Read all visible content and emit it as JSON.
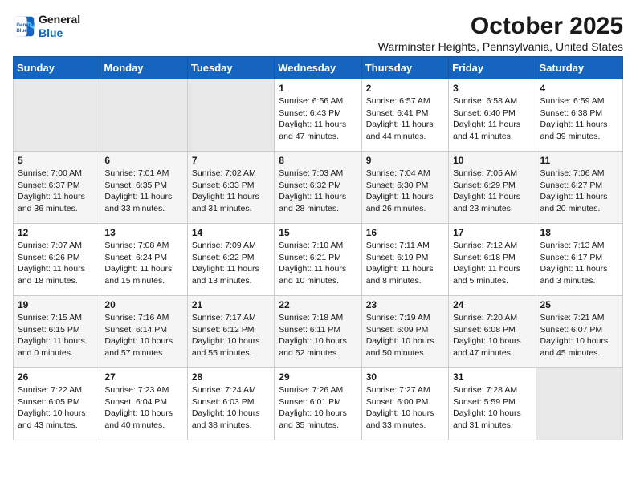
{
  "logo": {
    "line1": "General",
    "line2": "Blue"
  },
  "title": "October 2025",
  "subtitle": "Warminster Heights, Pennsylvania, United States",
  "weekdays": [
    "Sunday",
    "Monday",
    "Tuesday",
    "Wednesday",
    "Thursday",
    "Friday",
    "Saturday"
  ],
  "weeks": [
    [
      {
        "day": "",
        "sunrise": "",
        "sunset": "",
        "daylight": ""
      },
      {
        "day": "",
        "sunrise": "",
        "sunset": "",
        "daylight": ""
      },
      {
        "day": "",
        "sunrise": "",
        "sunset": "",
        "daylight": ""
      },
      {
        "day": "1",
        "sunrise": "Sunrise: 6:56 AM",
        "sunset": "Sunset: 6:43 PM",
        "daylight": "Daylight: 11 hours and 47 minutes."
      },
      {
        "day": "2",
        "sunrise": "Sunrise: 6:57 AM",
        "sunset": "Sunset: 6:41 PM",
        "daylight": "Daylight: 11 hours and 44 minutes."
      },
      {
        "day": "3",
        "sunrise": "Sunrise: 6:58 AM",
        "sunset": "Sunset: 6:40 PM",
        "daylight": "Daylight: 11 hours and 41 minutes."
      },
      {
        "day": "4",
        "sunrise": "Sunrise: 6:59 AM",
        "sunset": "Sunset: 6:38 PM",
        "daylight": "Daylight: 11 hours and 39 minutes."
      }
    ],
    [
      {
        "day": "5",
        "sunrise": "Sunrise: 7:00 AM",
        "sunset": "Sunset: 6:37 PM",
        "daylight": "Daylight: 11 hours and 36 minutes."
      },
      {
        "day": "6",
        "sunrise": "Sunrise: 7:01 AM",
        "sunset": "Sunset: 6:35 PM",
        "daylight": "Daylight: 11 hours and 33 minutes."
      },
      {
        "day": "7",
        "sunrise": "Sunrise: 7:02 AM",
        "sunset": "Sunset: 6:33 PM",
        "daylight": "Daylight: 11 hours and 31 minutes."
      },
      {
        "day": "8",
        "sunrise": "Sunrise: 7:03 AM",
        "sunset": "Sunset: 6:32 PM",
        "daylight": "Daylight: 11 hours and 28 minutes."
      },
      {
        "day": "9",
        "sunrise": "Sunrise: 7:04 AM",
        "sunset": "Sunset: 6:30 PM",
        "daylight": "Daylight: 11 hours and 26 minutes."
      },
      {
        "day": "10",
        "sunrise": "Sunrise: 7:05 AM",
        "sunset": "Sunset: 6:29 PM",
        "daylight": "Daylight: 11 hours and 23 minutes."
      },
      {
        "day": "11",
        "sunrise": "Sunrise: 7:06 AM",
        "sunset": "Sunset: 6:27 PM",
        "daylight": "Daylight: 11 hours and 20 minutes."
      }
    ],
    [
      {
        "day": "12",
        "sunrise": "Sunrise: 7:07 AM",
        "sunset": "Sunset: 6:26 PM",
        "daylight": "Daylight: 11 hours and 18 minutes."
      },
      {
        "day": "13",
        "sunrise": "Sunrise: 7:08 AM",
        "sunset": "Sunset: 6:24 PM",
        "daylight": "Daylight: 11 hours and 15 minutes."
      },
      {
        "day": "14",
        "sunrise": "Sunrise: 7:09 AM",
        "sunset": "Sunset: 6:22 PM",
        "daylight": "Daylight: 11 hours and 13 minutes."
      },
      {
        "day": "15",
        "sunrise": "Sunrise: 7:10 AM",
        "sunset": "Sunset: 6:21 PM",
        "daylight": "Daylight: 11 hours and 10 minutes."
      },
      {
        "day": "16",
        "sunrise": "Sunrise: 7:11 AM",
        "sunset": "Sunset: 6:19 PM",
        "daylight": "Daylight: 11 hours and 8 minutes."
      },
      {
        "day": "17",
        "sunrise": "Sunrise: 7:12 AM",
        "sunset": "Sunset: 6:18 PM",
        "daylight": "Daylight: 11 hours and 5 minutes."
      },
      {
        "day": "18",
        "sunrise": "Sunrise: 7:13 AM",
        "sunset": "Sunset: 6:17 PM",
        "daylight": "Daylight: 11 hours and 3 minutes."
      }
    ],
    [
      {
        "day": "19",
        "sunrise": "Sunrise: 7:15 AM",
        "sunset": "Sunset: 6:15 PM",
        "daylight": "Daylight: 11 hours and 0 minutes."
      },
      {
        "day": "20",
        "sunrise": "Sunrise: 7:16 AM",
        "sunset": "Sunset: 6:14 PM",
        "daylight": "Daylight: 10 hours and 57 minutes."
      },
      {
        "day": "21",
        "sunrise": "Sunrise: 7:17 AM",
        "sunset": "Sunset: 6:12 PM",
        "daylight": "Daylight: 10 hours and 55 minutes."
      },
      {
        "day": "22",
        "sunrise": "Sunrise: 7:18 AM",
        "sunset": "Sunset: 6:11 PM",
        "daylight": "Daylight: 10 hours and 52 minutes."
      },
      {
        "day": "23",
        "sunrise": "Sunrise: 7:19 AM",
        "sunset": "Sunset: 6:09 PM",
        "daylight": "Daylight: 10 hours and 50 minutes."
      },
      {
        "day": "24",
        "sunrise": "Sunrise: 7:20 AM",
        "sunset": "Sunset: 6:08 PM",
        "daylight": "Daylight: 10 hours and 47 minutes."
      },
      {
        "day": "25",
        "sunrise": "Sunrise: 7:21 AM",
        "sunset": "Sunset: 6:07 PM",
        "daylight": "Daylight: 10 hours and 45 minutes."
      }
    ],
    [
      {
        "day": "26",
        "sunrise": "Sunrise: 7:22 AM",
        "sunset": "Sunset: 6:05 PM",
        "daylight": "Daylight: 10 hours and 43 minutes."
      },
      {
        "day": "27",
        "sunrise": "Sunrise: 7:23 AM",
        "sunset": "Sunset: 6:04 PM",
        "daylight": "Daylight: 10 hours and 40 minutes."
      },
      {
        "day": "28",
        "sunrise": "Sunrise: 7:24 AM",
        "sunset": "Sunset: 6:03 PM",
        "daylight": "Daylight: 10 hours and 38 minutes."
      },
      {
        "day": "29",
        "sunrise": "Sunrise: 7:26 AM",
        "sunset": "Sunset: 6:01 PM",
        "daylight": "Daylight: 10 hours and 35 minutes."
      },
      {
        "day": "30",
        "sunrise": "Sunrise: 7:27 AM",
        "sunset": "Sunset: 6:00 PM",
        "daylight": "Daylight: 10 hours and 33 minutes."
      },
      {
        "day": "31",
        "sunrise": "Sunrise: 7:28 AM",
        "sunset": "Sunset: 5:59 PM",
        "daylight": "Daylight: 10 hours and 31 minutes."
      },
      {
        "day": "",
        "sunrise": "",
        "sunset": "",
        "daylight": ""
      }
    ]
  ]
}
